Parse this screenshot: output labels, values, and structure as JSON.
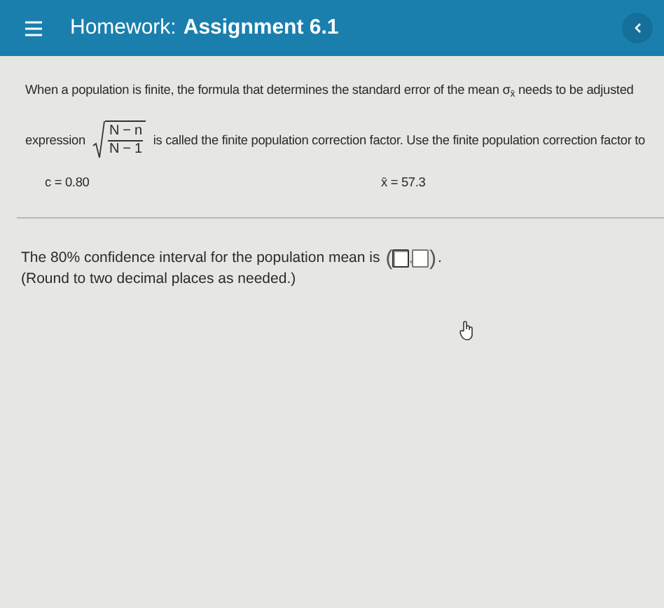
{
  "header": {
    "title_prefix": "Homework:",
    "title": "Assignment 6.1"
  },
  "intro": {
    "text": "When a population is finite, the formula that determines the standard error of the mean σ$_{x̄}$ needs to be adjusted"
  },
  "correction": {
    "before": "expression",
    "numerator": "N − n",
    "denominator": "N − 1",
    "after": "is called the finite population correction factor. Use the finite population correction factor to"
  },
  "givens": [
    {
      "text": "c = 0.80"
    },
    {
      "text": "x̄ = 57.3"
    }
  ],
  "question": {
    "text": "The 80% confidence interval for the population mean is",
    "open": "(",
    "separator": ",",
    "close": ")",
    "end": ".",
    "answers": [
      {
        "focused": true
      },
      {
        "focused": false
      }
    ],
    "note": "(Round to two decimal places as needed.)"
  }
}
